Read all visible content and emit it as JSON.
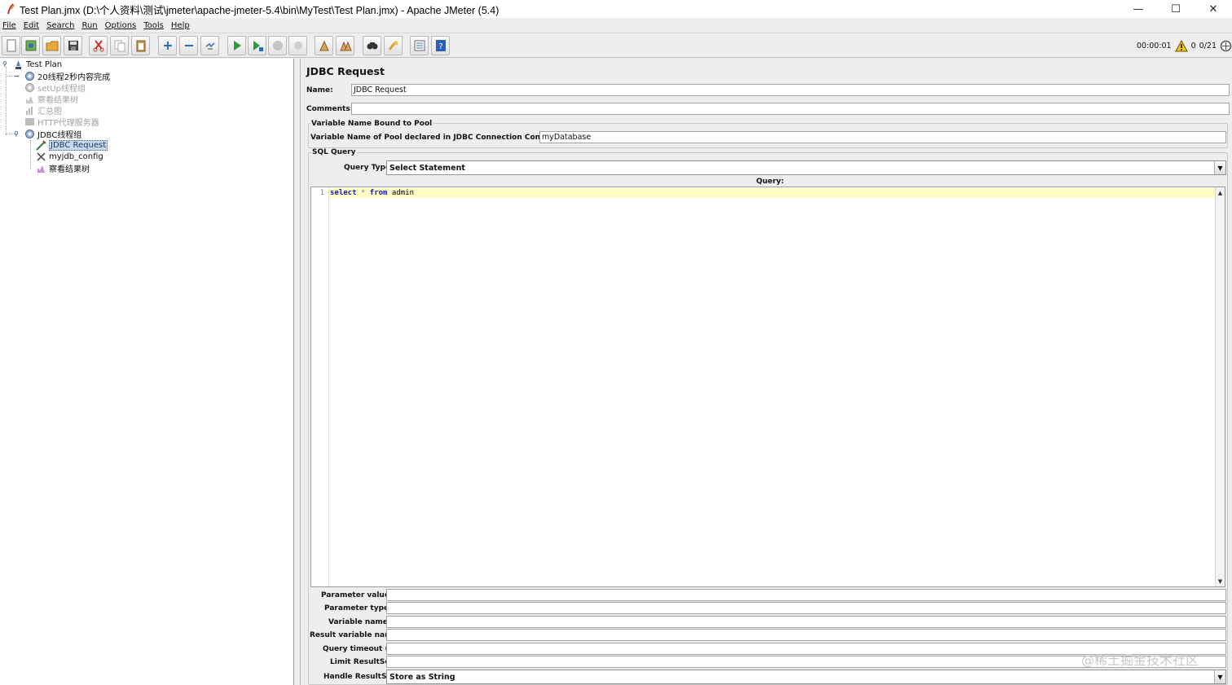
{
  "window": {
    "title": "Test Plan.jmx (D:\\个人资料\\测试\\jmeter\\apache-jmeter-5.4\\bin\\MyTest\\Test Plan.jmx) - Apache JMeter (5.4)",
    "minimize": "—",
    "maximize": "☐",
    "close": "✕"
  },
  "menu": [
    "File",
    "Edit",
    "Search",
    "Run",
    "Options",
    "Tools",
    "Help"
  ],
  "toolbar": {
    "icons": [
      "new-icon",
      "templates-icon",
      "open-icon",
      "save-icon",
      "cut-icon",
      "copy-icon",
      "paste-icon",
      "expand-icon",
      "collapse-icon",
      "toggle-icon",
      "start-icon",
      "start-no-pause-icon",
      "stop-icon",
      "shutdown-icon",
      "clear-icon",
      "clear-all-icon",
      "search-icon",
      "reset-search-icon",
      "function-helper-icon",
      "help-icon"
    ],
    "timer": "00:00:01",
    "warnings": "0",
    "threads": "0/21"
  },
  "tree": {
    "nodes": [
      {
        "label": "Test Plan",
        "icon": "test-plan-icon",
        "disabled": false,
        "selected": false
      },
      {
        "label": "20线程2秒内容完成",
        "icon": "thread-group-icon",
        "disabled": false,
        "selected": false
      },
      {
        "label": "setUp线程组",
        "icon": "thread-group-icon",
        "disabled": true,
        "selected": false
      },
      {
        "label": "察看结果树",
        "icon": "listener-icon",
        "disabled": true,
        "selected": false
      },
      {
        "label": "汇总图",
        "icon": "graph-icon",
        "disabled": true,
        "selected": false
      },
      {
        "label": "HTTP代理服务器",
        "icon": "proxy-icon",
        "disabled": true,
        "selected": false
      },
      {
        "label": "JDBC线程组",
        "icon": "thread-group-icon",
        "disabled": false,
        "selected": false
      },
      {
        "label": "JDBC Request",
        "icon": "sampler-icon",
        "disabled": false,
        "selected": true
      },
      {
        "label": "myjdb_config",
        "icon": "config-icon",
        "disabled": false,
        "selected": false
      },
      {
        "label": "察看结果树",
        "icon": "listener-icon",
        "disabled": false,
        "selected": false
      }
    ]
  },
  "form": {
    "title": "JDBC Request",
    "name_label": "Name:",
    "name_value": "JDBC Request",
    "comments_label": "Comments:",
    "comments_value": "",
    "pool_group_title": "Variable Name Bound to Pool",
    "pool_label": "Variable Name of Pool declared in JDBC Connection Configuration:",
    "pool_value": "myDatabase",
    "sql_group_title": "SQL Query",
    "query_type_label": "Query Type:",
    "query_type_value": "Select Statement",
    "query_label": "Query:",
    "query_line_number": "1",
    "query_tokens": {
      "kw1": "select",
      "star": "*",
      "kw2": "from",
      "table": "admin"
    },
    "param_values_label": "Parameter values:",
    "param_types_label": "Parameter types:",
    "var_names_label": "Variable names:",
    "result_var_label": "Result variable name:",
    "timeout_label": "Query timeout (s):",
    "limit_label": "Limit ResultSet:",
    "handle_label": "Handle ResultSet:",
    "handle_value": "Store as String"
  },
  "watermark": "@稀土掘金技术社区"
}
